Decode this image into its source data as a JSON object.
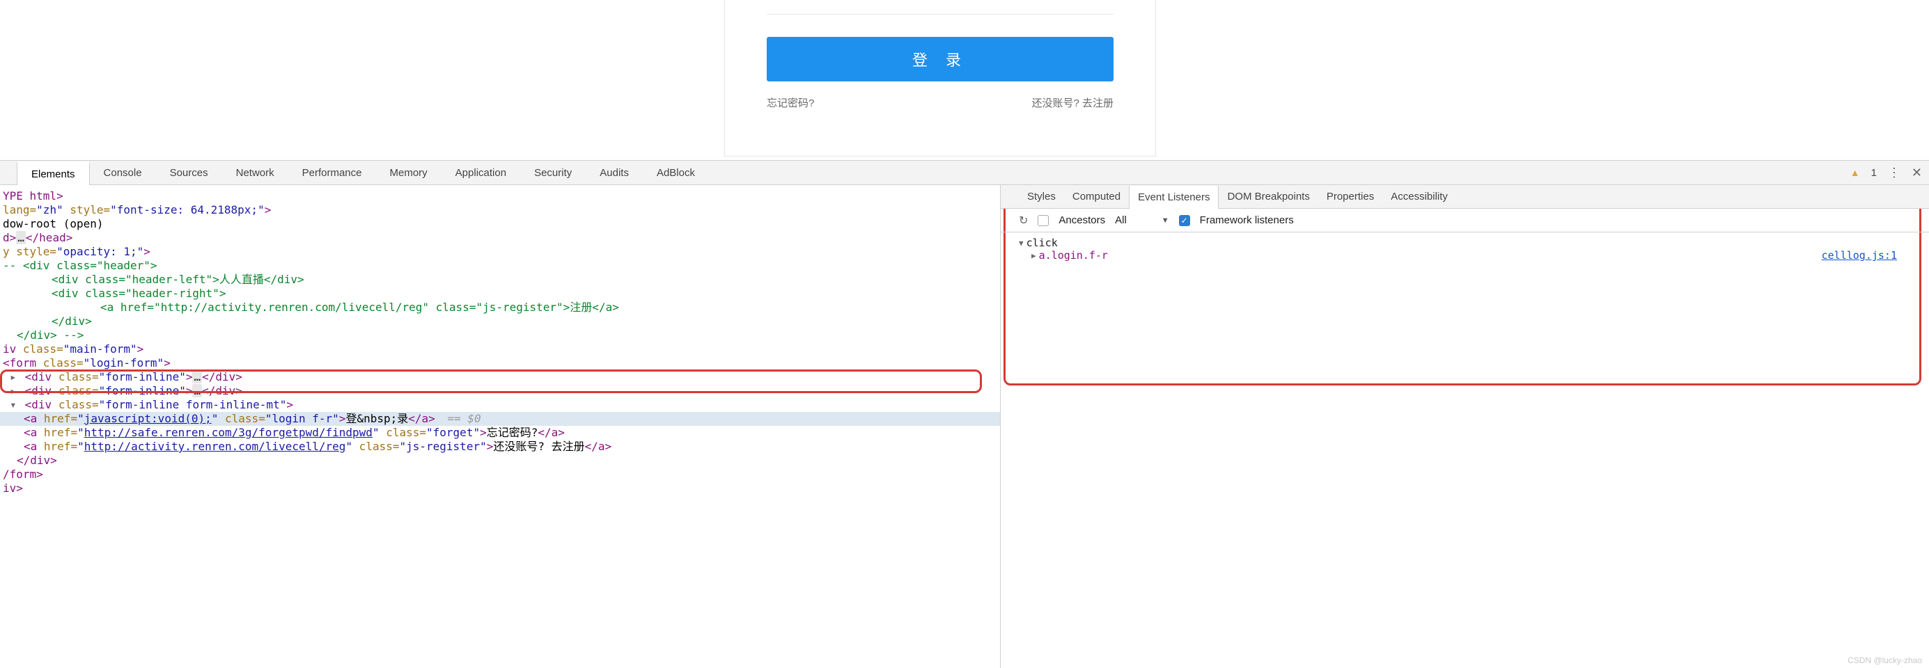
{
  "form": {
    "login_button": "登 录",
    "forgot": "忘记密码?",
    "register": "还没账号? 去注册"
  },
  "devtools": {
    "tabs": [
      "Elements",
      "Console",
      "Sources",
      "Network",
      "Performance",
      "Memory",
      "Application",
      "Security",
      "Audits",
      "AdBlock"
    ],
    "active_tab": "Elements",
    "warnings": "1"
  },
  "dom": {
    "l0": "YPE html>",
    "l1a": " lang=",
    "l1b": "\"zh\"",
    "l1c": " style=",
    "l1d": "\"font-size: 64.2188px;\"",
    "l1e": ">",
    "l2": "dow-root (open)",
    "l3a": "d>",
    "l3b": "…",
    "l3c": "</head>",
    "l4a": "y style=",
    "l4b": "\"opacity: 1;\"",
    "l4c": ">",
    "l5a": "-- ",
    "l5b": "<div class=\"header\">",
    "l6a": "<div class=\"header-left\">",
    "l6b": "人人直播",
    "l6c": "</div>",
    "l7": "<div class=\"header-right\">",
    "l8a": "<a href=\"",
    "l8b": "http://activity.renren.com/livecell/reg",
    "l8c": "\" class=\"js-register\">",
    "l8d": "注册",
    "l8e": "</a>",
    "l9": "</div>",
    "l10": "</div> -->",
    "l11a": "iv ",
    "l11b": "class=",
    "l11c": "\"main-form\"",
    "l11d": ">",
    "l12a": "<form ",
    "l12b": "class=",
    "l12c": "\"login-form\"",
    "l12d": ">",
    "l13a": "<div ",
    "l13b": "class=",
    "l13c": "\"form-inline\"",
    "l13d": ">",
    "l13e": "…",
    "l13f": "</div>",
    "l14a": "<div ",
    "l14b": "class=",
    "l14c": "\"form-inline form-inline-mt\"",
    "l14d": ">",
    "l15a": "<a ",
    "l15b": "href=",
    "l15c": "\"",
    "l15d": "javascript:void(0);",
    "l15e": "\"",
    "l15f": " class=",
    "l15g": "\"login f-r\"",
    "l15h": ">",
    "l15i": "登&nbsp;录",
    "l15j": "</a>",
    "l15k": " == $0",
    "l16a": "<a ",
    "l16b": "href=",
    "l16c": "\"",
    "l16d": "http://safe.renren.com/3g/forgetpwd/findpwd",
    "l16e": "\"",
    "l16f": " class=",
    "l16g": "\"forget\"",
    "l16h": ">",
    "l16i": "忘记密码?",
    "l16j": "</a>",
    "l17a": "<a ",
    "l17b": "href=",
    "l17c": "\"",
    "l17d": "http://activity.renren.com/livecell/reg",
    "l17e": "\"",
    "l17f": " class=",
    "l17g": "\"js-register\"",
    "l17h": ">",
    "l17i": "还没账号? 去注册",
    "l17j": "</a>",
    "l18": "</div>",
    "l19": "/form>",
    "l20": "iv>"
  },
  "side": {
    "tabs": [
      "Styles",
      "Computed",
      "Event Listeners",
      "DOM Breakpoints",
      "Properties",
      "Accessibility"
    ],
    "active": "Event Listeners",
    "ancestors_label": "Ancestors",
    "scope": "All",
    "framework_label": "Framework listeners",
    "event_name": "click",
    "listener": "a.login.f-r",
    "src": "celllog.js:1"
  },
  "watermark": "CSDN @lucky-zhao"
}
